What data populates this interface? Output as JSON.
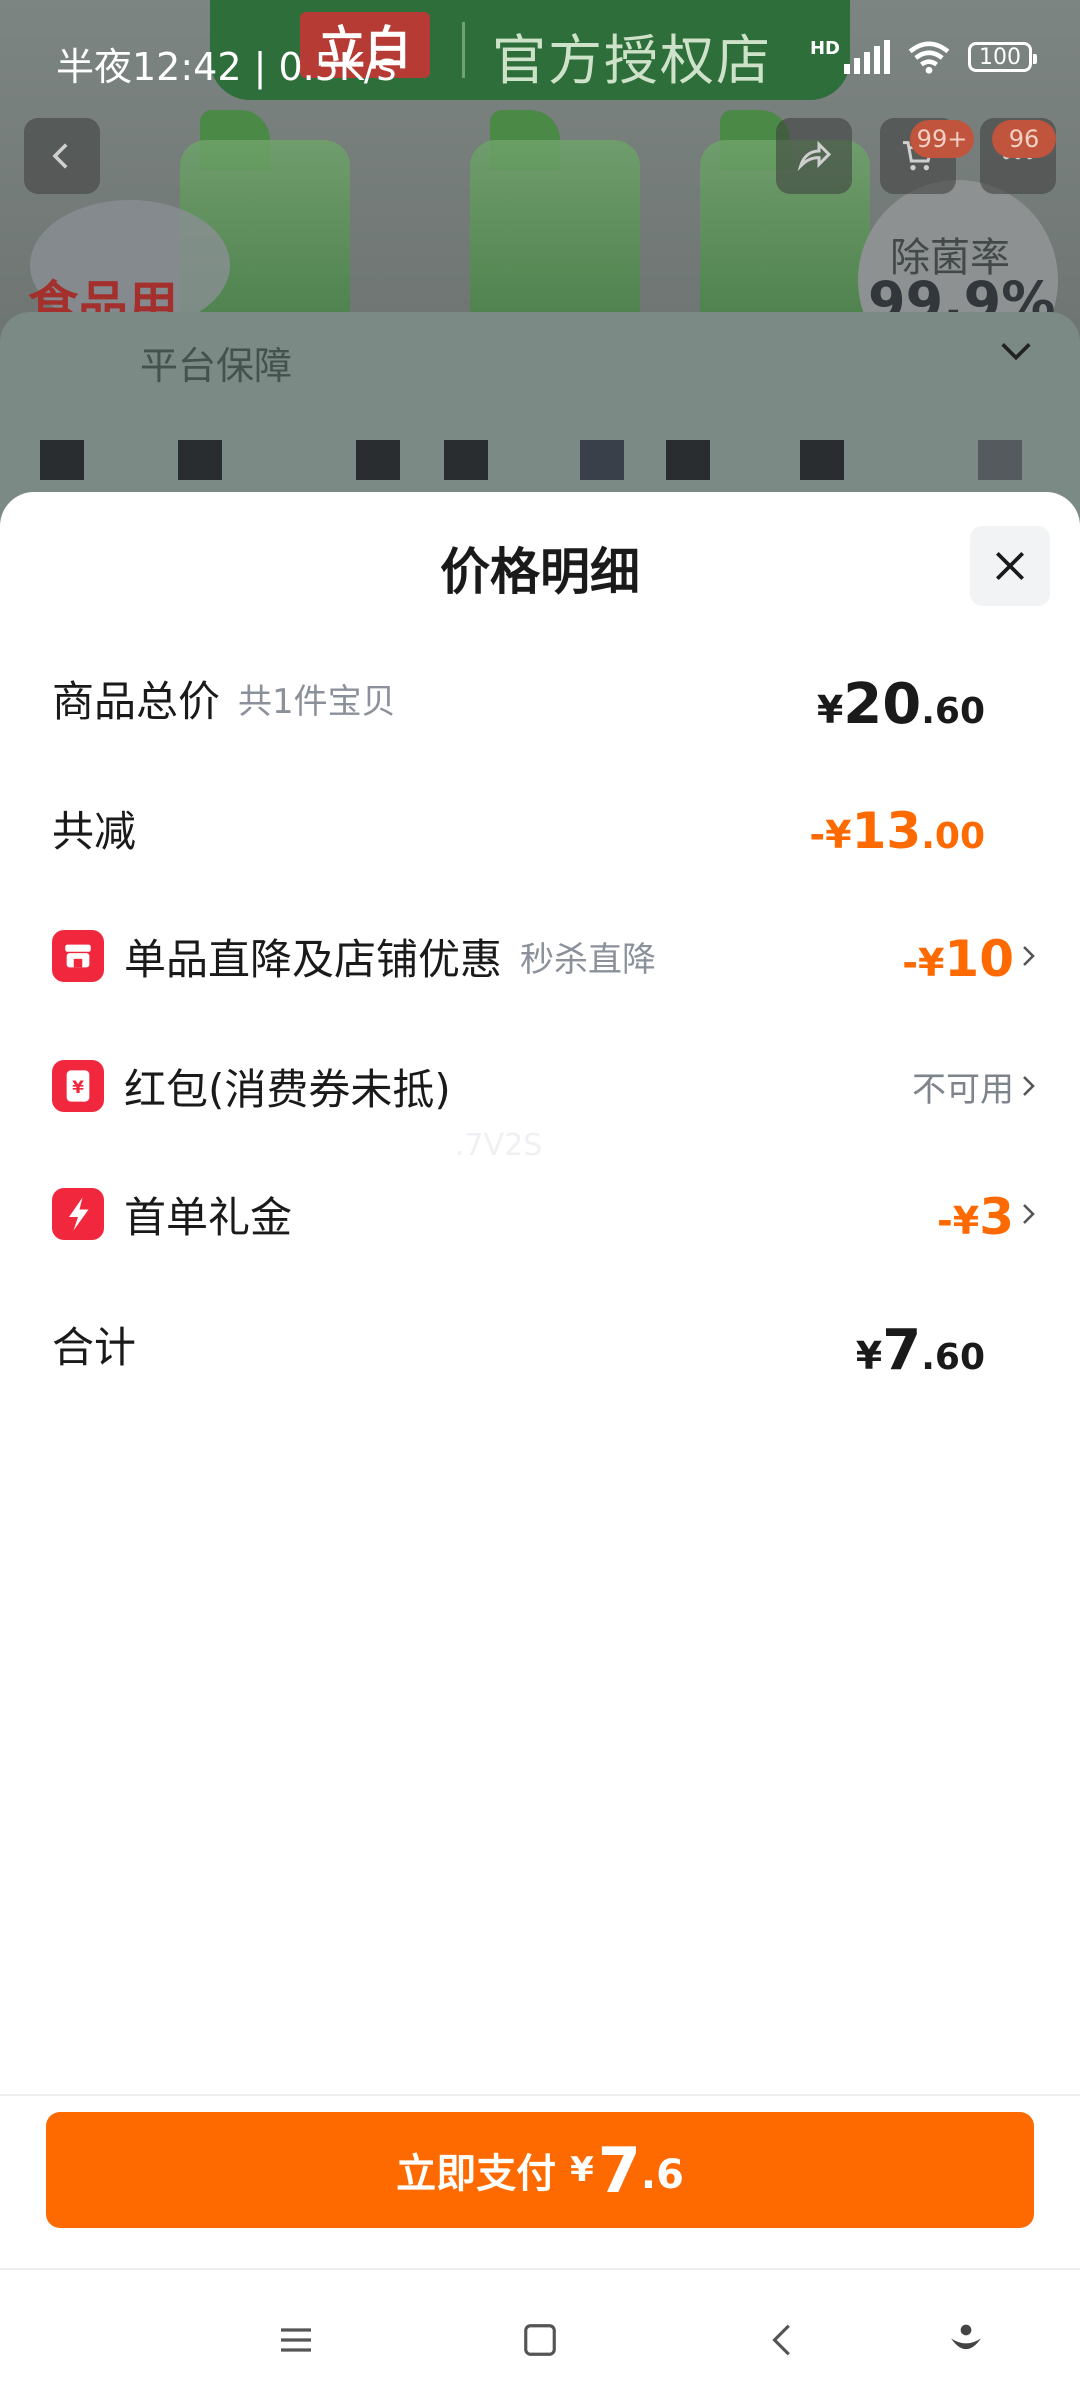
{
  "status_bar": {
    "time": "半夜12:42",
    "speed": "0.5K/s",
    "network_label": "HD",
    "battery": "100"
  },
  "background": {
    "shop_banner": "官方授权店",
    "logo_text": "立白",
    "badge_text": "食品用",
    "rate_label": "除菌率",
    "rate_value": "99.9%",
    "cart_count": "99+",
    "more_count": "96",
    "panel_text": "平台保障"
  },
  "sheet": {
    "title": "价格明细",
    "rows": [
      {
        "label": "商品总价",
        "sub": "共1件宝贝",
        "currency": "¥",
        "int": "20",
        "dec": ".60"
      },
      {
        "label": "共减",
        "currency": "-¥",
        "int": "13",
        "dec": ".00"
      },
      {
        "label": "单品直降及店铺优惠",
        "sub": "秒杀直降",
        "currency": "-¥",
        "int": "10",
        "icon": "store-icon"
      },
      {
        "label": "红包(消费券未抵)",
        "value_text": "不可用",
        "icon": "red-packet-icon"
      },
      {
        "label": "首单礼金",
        "currency": "-¥",
        "int": "3",
        "icon": "lightning-icon"
      },
      {
        "label": "合计",
        "currency": "¥",
        "int": "7",
        "dec": ".60"
      }
    ],
    "watermark": ".7V2S"
  },
  "pay_button": {
    "label": "立即支付",
    "currency": "¥",
    "int": "7",
    "dec": ".6"
  },
  "colors": {
    "accent": "#ff6a00",
    "icon_red": "#f1283d",
    "muted": "#8b919a"
  }
}
